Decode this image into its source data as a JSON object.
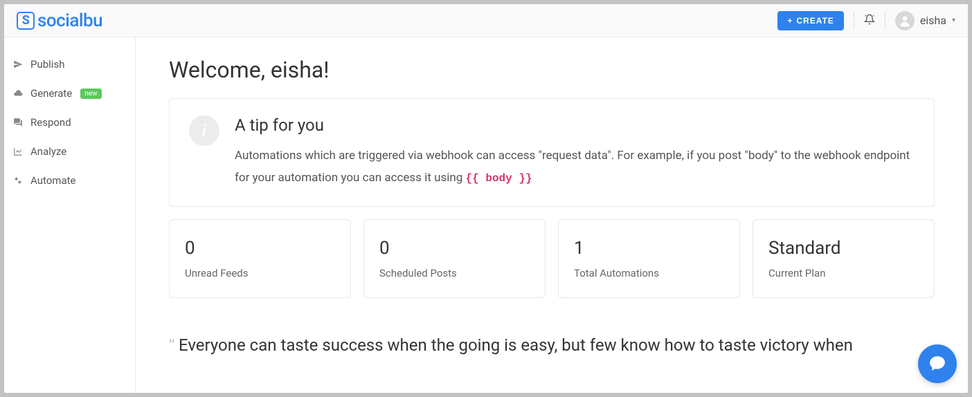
{
  "brand": "socialbu",
  "topbar": {
    "create_label": "CREATE",
    "username": "eisha"
  },
  "sidebar": {
    "items": [
      {
        "label": "Publish",
        "badge": null
      },
      {
        "label": "Generate",
        "badge": "new"
      },
      {
        "label": "Respond",
        "badge": null
      },
      {
        "label": "Analyze",
        "badge": null
      },
      {
        "label": "Automate",
        "badge": null
      }
    ]
  },
  "main": {
    "welcome": "Welcome, eisha!",
    "tip": {
      "title": "A tip for you",
      "text_pre": "Automations which are triggered via webhook can access \"request data\". For example, if you post \"body\" to the webhook endpoint for your automation you can access it using ",
      "code": "{{ body }}"
    },
    "stats": [
      {
        "value": "0",
        "label": "Unread Feeds"
      },
      {
        "value": "0",
        "label": "Scheduled Posts"
      },
      {
        "value": "1",
        "label": "Total Automations"
      },
      {
        "value": "Standard",
        "label": "Current Plan"
      }
    ],
    "quote": "Everyone can taste success when the going is easy, but few know how to taste victory when"
  }
}
